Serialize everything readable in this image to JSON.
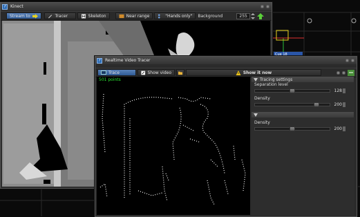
{
  "kinect": {
    "title": "Kinect",
    "stream_label": "Stream to",
    "tracer_label": "Tracer",
    "skeleton_label": "Skeleton",
    "near_range_label": "Near range",
    "hands_only_label": "\"Hands only\"",
    "background_label": "Background",
    "background_value": "255"
  },
  "cue": {
    "label": "Cue 18"
  },
  "tracer": {
    "title": "Realtime Video Tracer",
    "trace_label": "Trace",
    "show_video_label": "Show video",
    "show_it_now_label": "Show it now",
    "points_label": "501 points",
    "settings": {
      "section_title": "Tracing settings",
      "separation_label": "Separation level",
      "separation_value": "128",
      "separation_level": 0.5,
      "density_label": "Density",
      "density_value": "200",
      "density_level": 0.78
    },
    "settings2": {
      "density_label": "Density",
      "density_value": "200",
      "density_level": 0.5
    }
  },
  "colors": {
    "accent": "#2f5b96",
    "points_green": "#29e02f",
    "cue_blue": "#2a56a8",
    "selection_yellow": "#e8d21c",
    "crosshair_red": "#e03030"
  }
}
